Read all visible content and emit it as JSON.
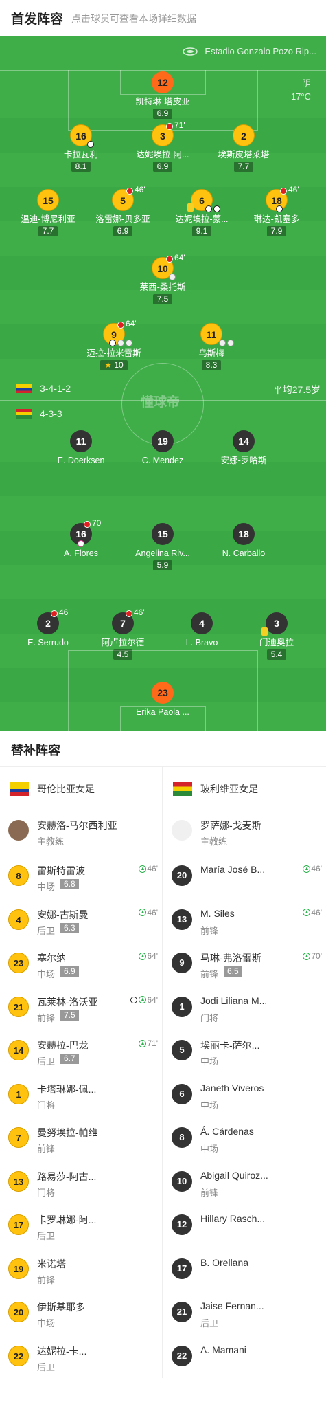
{
  "header": {
    "title": "首发阵容",
    "hint": "点击球员可查看本场详细数据"
  },
  "pitch": {
    "stadium": "Estadio Gonzalo Pozo Rip...",
    "weather": "阴",
    "temperature": "17°C",
    "watermark": "懂球帝",
    "home_formation": "3-4-1-2",
    "away_formation": "4-3-3",
    "avg_age": "平均27.5岁",
    "home_players": [
      {
        "num": "12",
        "name": "凯特琳-塔皮亚",
        "rating": "6.9",
        "kind": "gk"
      },
      {
        "num": "16",
        "name": "卡拉瓦利",
        "rating": "8.1"
      },
      {
        "num": "3",
        "name": "达妮埃拉-阿...",
        "rating": "6.9",
        "sub": "71'"
      },
      {
        "num": "2",
        "name": "埃斯皮塔莱塔",
        "rating": "7.7"
      },
      {
        "num": "15",
        "name": "温迪-博尼利亚",
        "rating": "7.7"
      },
      {
        "num": "5",
        "name": "洛雷娜-贝多亚",
        "rating": "6.9",
        "sub": "46'"
      },
      {
        "num": "6",
        "name": "达妮埃拉-蒙...",
        "rating": "9.1"
      },
      {
        "num": "18",
        "name": "琳达-凯塞多",
        "rating": "7.9",
        "sub": "46'"
      },
      {
        "num": "10",
        "name": "莱西-桑托斯",
        "rating": "7.5",
        "sub": "64'"
      },
      {
        "num": "9",
        "name": "迈拉-拉米雷斯",
        "rating": "10",
        "sub": "64'"
      },
      {
        "num": "11",
        "name": "乌斯梅",
        "rating": "8.3"
      }
    ],
    "away_players": [
      {
        "num": "11",
        "name": "E. Doerksen"
      },
      {
        "num": "19",
        "name": "C. Mendez"
      },
      {
        "num": "14",
        "name": "安娜-罗哈斯"
      },
      {
        "num": "16",
        "name": "A. Flores",
        "sub": "70'"
      },
      {
        "num": "15",
        "name": "Angelina Riv...",
        "rating": "5.9"
      },
      {
        "num": "18",
        "name": "N. Carballo"
      },
      {
        "num": "2",
        "name": "E. Serrudo",
        "sub": "46'"
      },
      {
        "num": "7",
        "name": "阿卢拉尔德",
        "rating": "4.5",
        "sub": "46'"
      },
      {
        "num": "4",
        "name": "L. Bravo"
      },
      {
        "num": "3",
        "name": "门迪奥拉",
        "rating": "5.4"
      },
      {
        "num": "23",
        "name": "Erika Paola ...",
        "kind": "gk"
      }
    ]
  },
  "subs": {
    "title": "替补阵容",
    "home": {
      "team": "哥伦比亚女足",
      "coach": {
        "name": "安赫洛-马尔西利亚",
        "role": "主教练"
      },
      "players": [
        {
          "num": "8",
          "name": "雷斯特雷波",
          "pos": "中场",
          "rating": "6.8",
          "time": "46'"
        },
        {
          "num": "4",
          "name": "安娜-古斯曼",
          "pos": "后卫",
          "rating": "6.3",
          "time": "46'"
        },
        {
          "num": "23",
          "name": "塞尔纳",
          "pos": "中场",
          "rating": "6.9",
          "time": "64'"
        },
        {
          "num": "21",
          "name": "瓦莱林-洛沃亚",
          "pos": "前锋",
          "rating": "7.5",
          "time": "64'",
          "goal": true
        },
        {
          "num": "14",
          "name": "安赫拉-巴龙",
          "pos": "后卫",
          "rating": "6.7",
          "time": "71'"
        },
        {
          "num": "1",
          "name": "卡塔琳娜-佩...",
          "pos": "门将"
        },
        {
          "num": "7",
          "name": "曼努埃拉-帕维",
          "pos": "前锋"
        },
        {
          "num": "13",
          "name": "路易莎-阿古...",
          "pos": "门将"
        },
        {
          "num": "17",
          "name": "卡罗琳娜-阿...",
          "pos": "后卫"
        },
        {
          "num": "19",
          "name": "米诺塔",
          "pos": "前锋"
        },
        {
          "num": "20",
          "name": "伊斯基耶多",
          "pos": "中场"
        },
        {
          "num": "22",
          "name": "达妮拉-卡...",
          "pos": "后卫"
        }
      ]
    },
    "away": {
      "team": "玻利维亚女足",
      "coach": {
        "name": "罗萨娜-戈麦斯",
        "role": "主教练"
      },
      "players": [
        {
          "num": "20",
          "name": "María José B...",
          "pos": "",
          "time": "46'"
        },
        {
          "num": "13",
          "name": "M. Siles",
          "pos": "前锋",
          "time": "46'"
        },
        {
          "num": "9",
          "name": "马琳-弗洛雷斯",
          "pos": "前锋",
          "rating": "6.5",
          "time": "70'"
        },
        {
          "num": "1",
          "name": "Jodi Liliana M...",
          "pos": "门将"
        },
        {
          "num": "5",
          "name": "埃丽卡-萨尔...",
          "pos": "中场"
        },
        {
          "num": "6",
          "name": "Janeth Viveros",
          "pos": "中场"
        },
        {
          "num": "8",
          "name": "Á. Cárdenas",
          "pos": "中场"
        },
        {
          "num": "10",
          "name": "Abigail Quiroz...",
          "pos": "前锋"
        },
        {
          "num": "12",
          "name": "Hillary Rasch...",
          "pos": ""
        },
        {
          "num": "17",
          "name": "B. Orellana",
          "pos": ""
        },
        {
          "num": "21",
          "name": "Jaise Fernan...",
          "pos": "后卫"
        },
        {
          "num": "22",
          "name": "A. Mamani",
          "pos": ""
        }
      ]
    }
  }
}
